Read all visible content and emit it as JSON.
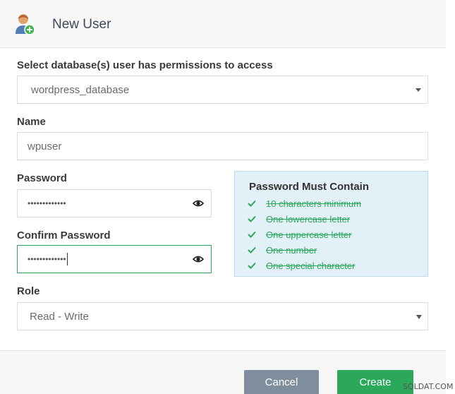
{
  "header": {
    "title": "New User",
    "icon": "user-add-icon"
  },
  "databases": {
    "label": "Select database(s) user has permissions to access",
    "selected": "wordpress_database"
  },
  "name": {
    "label": "Name",
    "value": "wpuser"
  },
  "password": {
    "label": "Password",
    "masked_value": "•••••••••••••"
  },
  "confirm_password": {
    "label": "Confirm Password",
    "masked_value": "•••••••••••••"
  },
  "requirements": {
    "title": "Password Must Contain",
    "items": [
      "10 characters minimum",
      "One lowercase letter",
      "One uppercase letter",
      "One number",
      "One special character"
    ],
    "met_color": "#2ca85a"
  },
  "role": {
    "label": "Role",
    "selected": "Read - Write"
  },
  "buttons": {
    "cancel": "Cancel",
    "create": "Create"
  },
  "watermark": "SQLDAT.COM",
  "colors": {
    "accent": "#2ca85a",
    "cancel": "#7e8e9c",
    "info_box": "#e2f0f7"
  }
}
